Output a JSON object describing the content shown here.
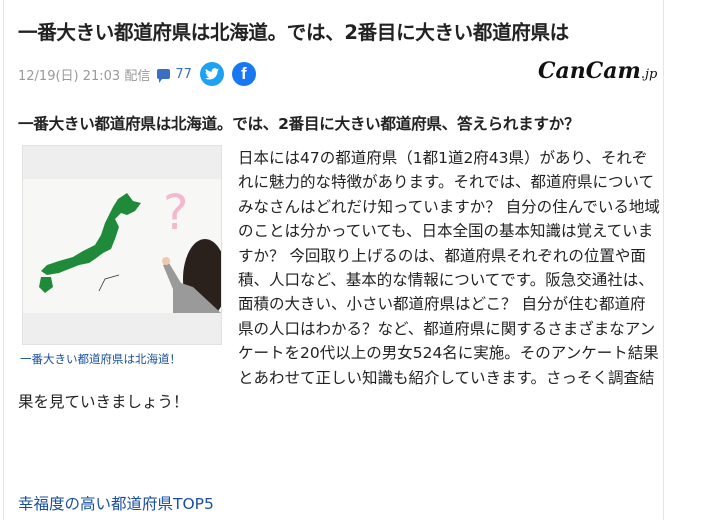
{
  "article": {
    "title": "一番大きい都道府県は北海道。では、2番目に大きい都道府県は",
    "date": "12/19(日) 21:03 配信",
    "comment_count": "77",
    "source_logo": "CanCam.jp",
    "subtitle": "一番大きい都道府県は北海道。では、2番目に大きい都道府県、答えられますか？",
    "image_caption": "一番大きい都道府県は北海道！",
    "body": "日本には47の都道府県（1都1道2府43県）があり、それぞれに魅力的な特徴があります。それでは、都道府県についてみなさんはどれだけ知っていますか？ 自分の住んでいる地域のことは分かっていても、日本全国の基本知識は覚えていますか？ 今回取り上げるのは、都道府県それぞれの位置や面積、人口など、基本的な情報についてです。阪急交通社は、面積の大きい、小さい都道府県はどこ？ 自分が住む都道府県の人口はわかる？など、都道府県に関するさまざまなアンケートを20代以上の男女524名に実施。そのアンケート結果とあわせて正しい知識も紹介していきます。さっそく調査結果を見ていきましょう！",
    "link": "幸福度の高い都道府県TOP5"
  },
  "icons": {
    "comment": "comment-icon",
    "twitter": "twitter-icon",
    "facebook": "facebook-icon"
  },
  "colors": {
    "link": "#1a4fa0",
    "twitter": "#1da1f2",
    "facebook": "#1877f2",
    "map": "#1f8a3a"
  }
}
